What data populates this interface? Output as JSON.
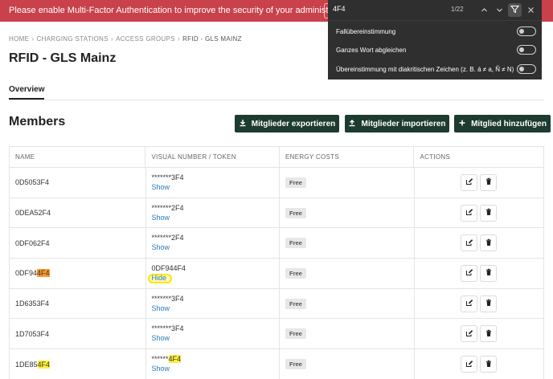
{
  "banner": {
    "text": "Please enable Multi-Factor Authentication to improve the security of your administrative account."
  },
  "breadcrumb": [
    "HOME",
    "CHARGING STATIONS",
    "ACCESS GROUPS",
    "RFID - GLS MAINZ"
  ],
  "page_title": "RFID - GLS Mainz",
  "tabs": [
    {
      "label": "Overview",
      "active": true
    }
  ],
  "members": {
    "title": "Members",
    "buttons": {
      "export": "Mitglieder exportieren",
      "import": "Mitglieder importieren",
      "add": "Mitglied hinzufügen"
    },
    "columns": [
      "NAME",
      "VISUAL NUMBER / TOKEN",
      "ENERGY COSTS",
      "ACTIONS"
    ],
    "rows": [
      {
        "name": "0D5053F4",
        "token": "*******3F4",
        "link": "Show",
        "energy": "Free"
      },
      {
        "name": "0DEA52F4",
        "token": "*******2F4",
        "link": "Show",
        "energy": "Free"
      },
      {
        "name": "0DF062F4",
        "token": "*******2F4",
        "link": "Show",
        "energy": "Free"
      },
      {
        "name_prefix": "0DF94",
        "name_match": "4F4",
        "token": "0DF944F4",
        "link": "Hide",
        "energy": "Free"
      },
      {
        "name": "1D6353F4",
        "token": "*******3F4",
        "link": "Show",
        "energy": "Free"
      },
      {
        "name": "1D7053F4",
        "token": "*******3F4",
        "link": "Show",
        "energy": "Free"
      },
      {
        "name_prefix": "1DE85",
        "name_match": "4F4",
        "token_prefix": "******",
        "token_match": "4F4",
        "link": "Show",
        "energy": "Free"
      }
    ]
  },
  "find_bar": {
    "query": "4F4",
    "count": "1/22",
    "options": [
      {
        "label": "Fallübereinstimmung",
        "enabled": false
      },
      {
        "label": "Ganzes Wort abgleichen",
        "enabled": false
      },
      {
        "label": "Übereinstimmung mit diakritischen Zeichen (z. B. á ≠ a, Ñ ≠ N)",
        "enabled": false
      }
    ]
  },
  "icons": [
    "download-icon",
    "upload-icon",
    "plus-icon",
    "edit-icon",
    "trash-icon",
    "chevron-up-icon",
    "chevron-down-icon",
    "filter-icon",
    "close-icon"
  ],
  "colors": {
    "banner": "#c8414b",
    "primary_button": "#1d3b2f",
    "link": "#2a7ab8",
    "highlight": "#ffef3d",
    "active_highlight": "#ff9a2e"
  }
}
